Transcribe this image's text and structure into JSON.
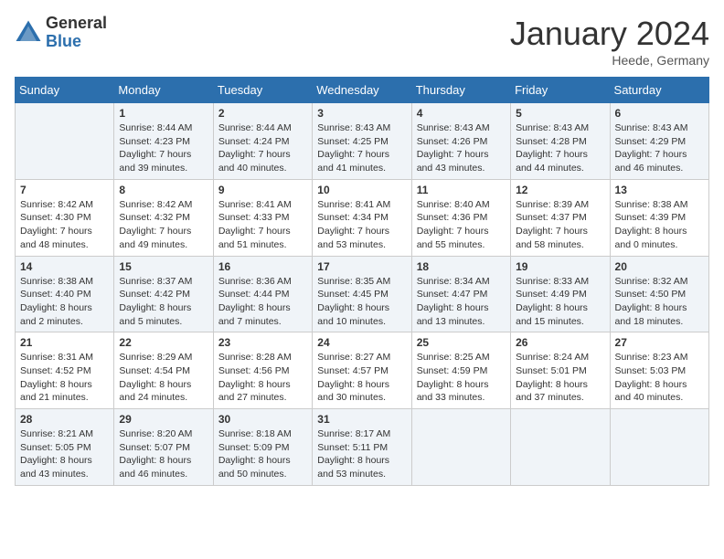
{
  "header": {
    "logo_general": "General",
    "logo_blue": "Blue",
    "month_title": "January 2024",
    "location": "Heede, Germany"
  },
  "days_of_week": [
    "Sunday",
    "Monday",
    "Tuesday",
    "Wednesday",
    "Thursday",
    "Friday",
    "Saturday"
  ],
  "weeks": [
    [
      {
        "day": "",
        "sunrise": "",
        "sunset": "",
        "daylight": ""
      },
      {
        "day": "1",
        "sunrise": "Sunrise: 8:44 AM",
        "sunset": "Sunset: 4:23 PM",
        "daylight": "Daylight: 7 hours and 39 minutes."
      },
      {
        "day": "2",
        "sunrise": "Sunrise: 8:44 AM",
        "sunset": "Sunset: 4:24 PM",
        "daylight": "Daylight: 7 hours and 40 minutes."
      },
      {
        "day": "3",
        "sunrise": "Sunrise: 8:43 AM",
        "sunset": "Sunset: 4:25 PM",
        "daylight": "Daylight: 7 hours and 41 minutes."
      },
      {
        "day": "4",
        "sunrise": "Sunrise: 8:43 AM",
        "sunset": "Sunset: 4:26 PM",
        "daylight": "Daylight: 7 hours and 43 minutes."
      },
      {
        "day": "5",
        "sunrise": "Sunrise: 8:43 AM",
        "sunset": "Sunset: 4:28 PM",
        "daylight": "Daylight: 7 hours and 44 minutes."
      },
      {
        "day": "6",
        "sunrise": "Sunrise: 8:43 AM",
        "sunset": "Sunset: 4:29 PM",
        "daylight": "Daylight: 7 hours and 46 minutes."
      }
    ],
    [
      {
        "day": "7",
        "sunrise": "Sunrise: 8:42 AM",
        "sunset": "Sunset: 4:30 PM",
        "daylight": "Daylight: 7 hours and 48 minutes."
      },
      {
        "day": "8",
        "sunrise": "Sunrise: 8:42 AM",
        "sunset": "Sunset: 4:32 PM",
        "daylight": "Daylight: 7 hours and 49 minutes."
      },
      {
        "day": "9",
        "sunrise": "Sunrise: 8:41 AM",
        "sunset": "Sunset: 4:33 PM",
        "daylight": "Daylight: 7 hours and 51 minutes."
      },
      {
        "day": "10",
        "sunrise": "Sunrise: 8:41 AM",
        "sunset": "Sunset: 4:34 PM",
        "daylight": "Daylight: 7 hours and 53 minutes."
      },
      {
        "day": "11",
        "sunrise": "Sunrise: 8:40 AM",
        "sunset": "Sunset: 4:36 PM",
        "daylight": "Daylight: 7 hours and 55 minutes."
      },
      {
        "day": "12",
        "sunrise": "Sunrise: 8:39 AM",
        "sunset": "Sunset: 4:37 PM",
        "daylight": "Daylight: 7 hours and 58 minutes."
      },
      {
        "day": "13",
        "sunrise": "Sunrise: 8:38 AM",
        "sunset": "Sunset: 4:39 PM",
        "daylight": "Daylight: 8 hours and 0 minutes."
      }
    ],
    [
      {
        "day": "14",
        "sunrise": "Sunrise: 8:38 AM",
        "sunset": "Sunset: 4:40 PM",
        "daylight": "Daylight: 8 hours and 2 minutes."
      },
      {
        "day": "15",
        "sunrise": "Sunrise: 8:37 AM",
        "sunset": "Sunset: 4:42 PM",
        "daylight": "Daylight: 8 hours and 5 minutes."
      },
      {
        "day": "16",
        "sunrise": "Sunrise: 8:36 AM",
        "sunset": "Sunset: 4:44 PM",
        "daylight": "Daylight: 8 hours and 7 minutes."
      },
      {
        "day": "17",
        "sunrise": "Sunrise: 8:35 AM",
        "sunset": "Sunset: 4:45 PM",
        "daylight": "Daylight: 8 hours and 10 minutes."
      },
      {
        "day": "18",
        "sunrise": "Sunrise: 8:34 AM",
        "sunset": "Sunset: 4:47 PM",
        "daylight": "Daylight: 8 hours and 13 minutes."
      },
      {
        "day": "19",
        "sunrise": "Sunrise: 8:33 AM",
        "sunset": "Sunset: 4:49 PM",
        "daylight": "Daylight: 8 hours and 15 minutes."
      },
      {
        "day": "20",
        "sunrise": "Sunrise: 8:32 AM",
        "sunset": "Sunset: 4:50 PM",
        "daylight": "Daylight: 8 hours and 18 minutes."
      }
    ],
    [
      {
        "day": "21",
        "sunrise": "Sunrise: 8:31 AM",
        "sunset": "Sunset: 4:52 PM",
        "daylight": "Daylight: 8 hours and 21 minutes."
      },
      {
        "day": "22",
        "sunrise": "Sunrise: 8:29 AM",
        "sunset": "Sunset: 4:54 PM",
        "daylight": "Daylight: 8 hours and 24 minutes."
      },
      {
        "day": "23",
        "sunrise": "Sunrise: 8:28 AM",
        "sunset": "Sunset: 4:56 PM",
        "daylight": "Daylight: 8 hours and 27 minutes."
      },
      {
        "day": "24",
        "sunrise": "Sunrise: 8:27 AM",
        "sunset": "Sunset: 4:57 PM",
        "daylight": "Daylight: 8 hours and 30 minutes."
      },
      {
        "day": "25",
        "sunrise": "Sunrise: 8:25 AM",
        "sunset": "Sunset: 4:59 PM",
        "daylight": "Daylight: 8 hours and 33 minutes."
      },
      {
        "day": "26",
        "sunrise": "Sunrise: 8:24 AM",
        "sunset": "Sunset: 5:01 PM",
        "daylight": "Daylight: 8 hours and 37 minutes."
      },
      {
        "day": "27",
        "sunrise": "Sunrise: 8:23 AM",
        "sunset": "Sunset: 5:03 PM",
        "daylight": "Daylight: 8 hours and 40 minutes."
      }
    ],
    [
      {
        "day": "28",
        "sunrise": "Sunrise: 8:21 AM",
        "sunset": "Sunset: 5:05 PM",
        "daylight": "Daylight: 8 hours and 43 minutes."
      },
      {
        "day": "29",
        "sunrise": "Sunrise: 8:20 AM",
        "sunset": "Sunset: 5:07 PM",
        "daylight": "Daylight: 8 hours and 46 minutes."
      },
      {
        "day": "30",
        "sunrise": "Sunrise: 8:18 AM",
        "sunset": "Sunset: 5:09 PM",
        "daylight": "Daylight: 8 hours and 50 minutes."
      },
      {
        "day": "31",
        "sunrise": "Sunrise: 8:17 AM",
        "sunset": "Sunset: 5:11 PM",
        "daylight": "Daylight: 8 hours and 53 minutes."
      },
      {
        "day": "",
        "sunrise": "",
        "sunset": "",
        "daylight": ""
      },
      {
        "day": "",
        "sunrise": "",
        "sunset": "",
        "daylight": ""
      },
      {
        "day": "",
        "sunrise": "",
        "sunset": "",
        "daylight": ""
      }
    ]
  ]
}
